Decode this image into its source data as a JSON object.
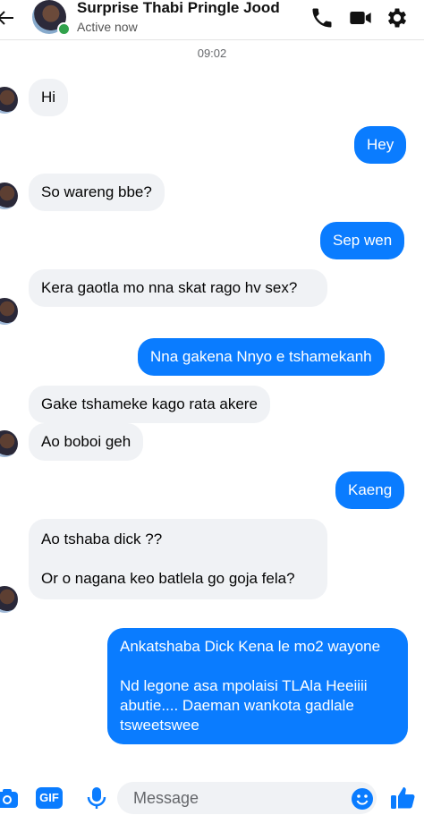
{
  "header": {
    "contact_name": "Surprise Thabi Pringle Jood",
    "status": "Active now",
    "icons": [
      "back-arrow-icon",
      "phone-icon",
      "video-camera-icon",
      "gear-icon"
    ]
  },
  "timestamp": "09:02",
  "messages": [
    {
      "from": "them",
      "text": "Hi"
    },
    {
      "from": "me",
      "text": "Hey"
    },
    {
      "from": "them",
      "text": "So wareng bbe?"
    },
    {
      "from": "me",
      "text": "Sep wen"
    },
    {
      "from": "them",
      "text": "Kera gaotla mo nna skat rago hv sex?"
    },
    {
      "from": "me",
      "text": "Nna gakena Nnyo e tshamekanh"
    },
    {
      "from": "them",
      "text": "Gake tshameke kago rata akere"
    },
    {
      "from": "them",
      "text": "Ao boboi geh"
    },
    {
      "from": "me",
      "text": "Kaeng"
    },
    {
      "from": "them",
      "text": "Ao tshaba dick ??\n\nOr o nagana keo batlela go goja fela?"
    },
    {
      "from": "me",
      "text": "Ankatshaba Dick Kena le mo2 wayone\n\nNd legone asa mpolaisi TLAla Heeiiii abutie.... Daeman wankota gadlale tsweetswee"
    }
  ],
  "composer": {
    "placeholder": "Message",
    "value": "",
    "gif_label": "GIF"
  },
  "colors": {
    "accent": "#0a7cff",
    "incoming_bubble": "#f0f2f5",
    "online": "#31a24c"
  }
}
